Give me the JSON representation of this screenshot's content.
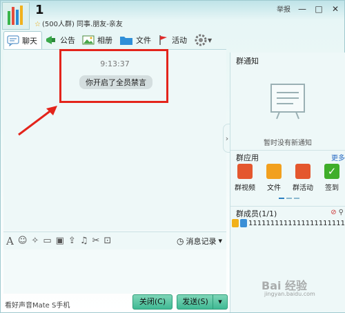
{
  "header": {
    "group_name": "1",
    "group_sub": "(500人群) 同事.朋友-亲友",
    "report_label": "举报",
    "minimize": "—",
    "maximize": "□",
    "close": "✕"
  },
  "toolbar": {
    "tabs": [
      {
        "label": "聊天",
        "icon": "chat-icon"
      },
      {
        "label": "公告",
        "icon": "announcement-icon"
      },
      {
        "label": "相册",
        "icon": "album-icon"
      },
      {
        "label": "文件",
        "icon": "folder-icon"
      },
      {
        "label": "活动",
        "icon": "flag-icon"
      }
    ],
    "settings_icon": "gear-icon"
  },
  "chat": {
    "timestamp": "9:13:37",
    "system_notice": "你开启了全员禁言"
  },
  "input_toolbar": {
    "font": "A",
    "history_label": "消息记录",
    "history_arrow": "▾"
  },
  "status": {
    "text": "看好声音Mate S手机"
  },
  "buttons": {
    "close_label": "关闭(C)",
    "send_label": "发送(S)",
    "send_dropdown": "▾"
  },
  "right_panel": {
    "notice_title": "群通知",
    "no_notice_text": "暂时没有新通知",
    "apps_title": "群应用",
    "more_label": "更多",
    "apps": [
      {
        "label": "群视频",
        "color": "#e4572e"
      },
      {
        "label": "文件",
        "color": "#f2a01e"
      },
      {
        "label": "群活动",
        "color": "#e4572e"
      },
      {
        "label": "签到",
        "color": "#3fae2a"
      }
    ],
    "members_title": "群成员(1/1)",
    "member": "1111111111111111111111"
  },
  "watermark": {
    "text": "Bai 经验",
    "url": "jingyan.baidu.com"
  },
  "colors": {
    "highlight_box": "#e3241b",
    "send_button": "#3fb993"
  }
}
